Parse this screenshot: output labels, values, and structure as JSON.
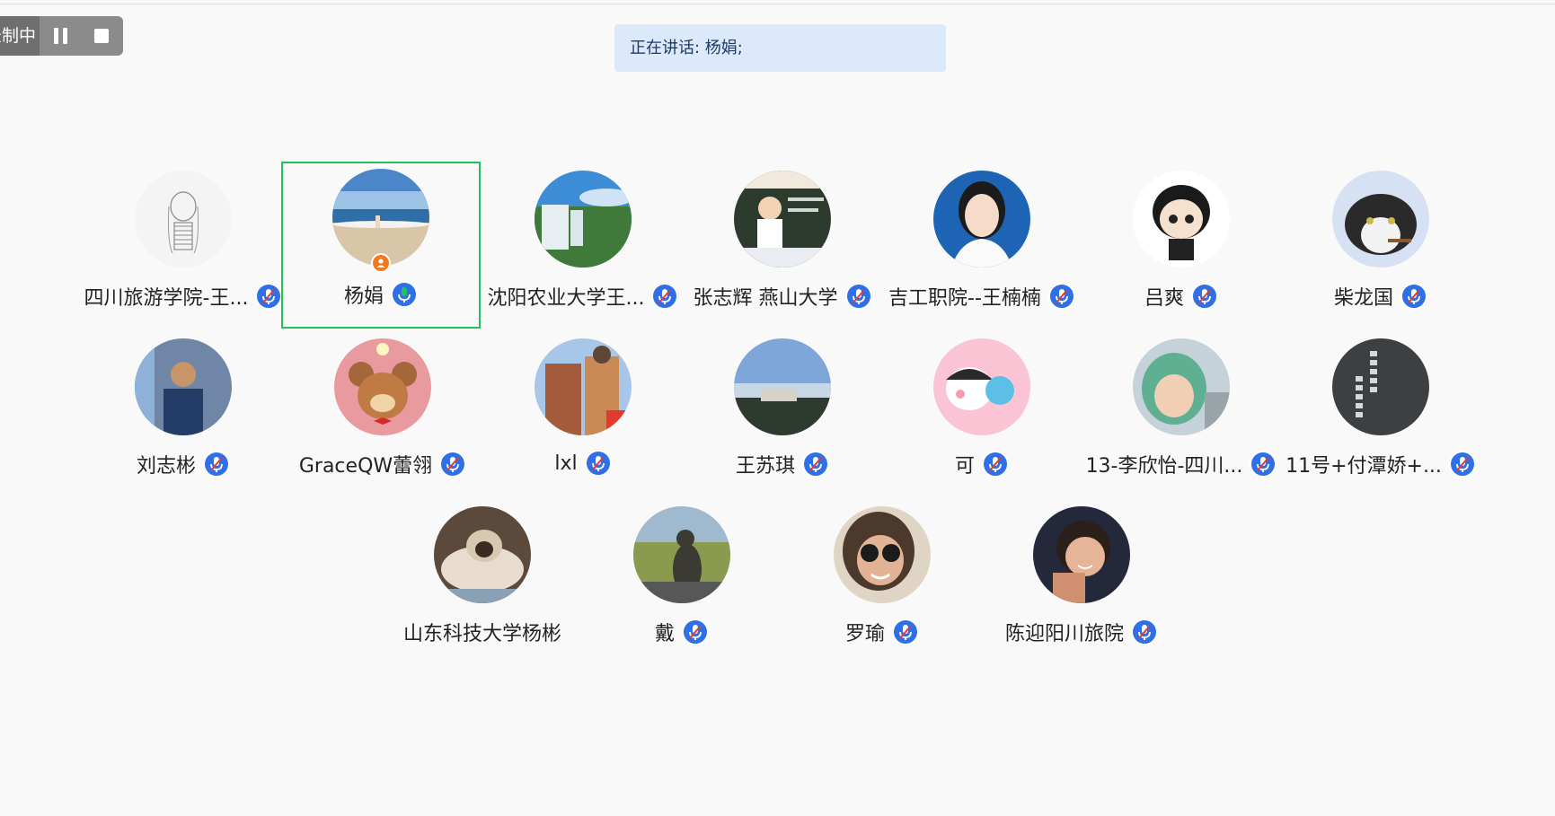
{
  "recording_bar": {
    "status_label": "录制中",
    "pause_icon": "pause-icon",
    "stop_icon": "stop-icon"
  },
  "speaking_banner": {
    "text": "正在讲话: 杨娟;"
  },
  "colors": {
    "active_border": "#21c35e",
    "mic_blue": "#2f6fe8",
    "mic_active_green": "#21c35e",
    "host_badge": "#f4791f",
    "banner_bg": "#dbe9fb"
  },
  "participants": [
    {
      "name": "四川旅游学院-王...",
      "mic": "muted",
      "avatar": "sketch-girl"
    },
    {
      "name": "杨娟",
      "mic": "speaking",
      "avatar": "beach",
      "active": true,
      "host": true
    },
    {
      "name": "沈阳农业大学王...",
      "mic": "muted",
      "avatar": "waterfall"
    },
    {
      "name": "张志辉 燕山大学",
      "mic": "muted",
      "avatar": "cartoon-teacher"
    },
    {
      "name": "吉工职院--王楠楠",
      "mic": "muted",
      "avatar": "portrait-woman"
    },
    {
      "name": "吕爽",
      "mic": "muted",
      "avatar": "cartoon-child"
    },
    {
      "name": "柴龙国",
      "mic": "muted",
      "avatar": "cat-cigar"
    },
    {
      "name": "刘志彬",
      "mic": "muted",
      "avatar": "man-speaking"
    },
    {
      "name": "GraceQW蕾翎",
      "mic": "muted",
      "avatar": "cartoon-mouse"
    },
    {
      "name": "lxl",
      "mic": "muted",
      "avatar": "building"
    },
    {
      "name": "王苏琪",
      "mic": "muted",
      "avatar": "sunset-town"
    },
    {
      "name": "可",
      "mic": "muted",
      "avatar": "bubble-girl"
    },
    {
      "name": "13-李欣怡-四川...",
      "mic": "muted",
      "avatar": "child-hood"
    },
    {
      "name": "11号+付潭娇+...",
      "mic": "muted",
      "avatar": "calligraphy"
    },
    {
      "name": "山东科技大学杨彬",
      "mic": "none",
      "avatar": "siamese-cat"
    },
    {
      "name": "戴",
      "mic": "muted",
      "avatar": "cat-field"
    },
    {
      "name": "罗瑜",
      "mic": "muted",
      "avatar": "woman-glasses"
    },
    {
      "name": "陈迎阳川旅院",
      "mic": "muted",
      "avatar": "woman-smiling"
    }
  ]
}
